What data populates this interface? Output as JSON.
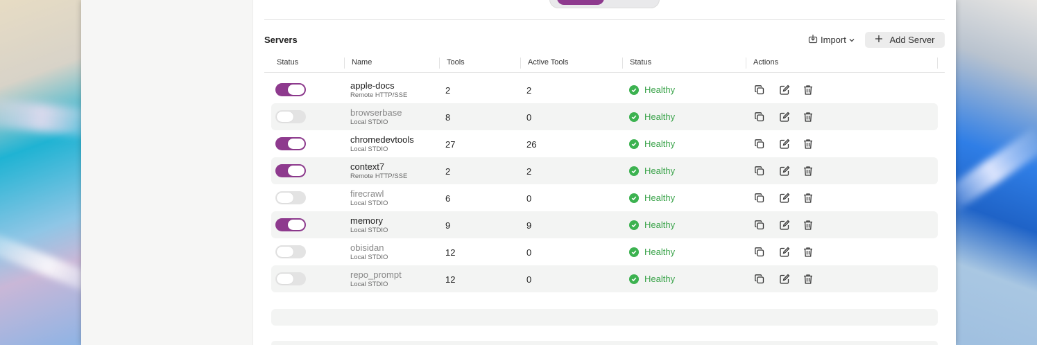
{
  "header": {
    "segment_active_color": "#8e3a8e"
  },
  "servers": {
    "title": "Servers",
    "import_label": "Import",
    "add_label": "Add Server"
  },
  "table": {
    "columns": [
      "Status",
      "Name",
      "Tools",
      "Active Tools",
      "Status",
      "Actions"
    ],
    "rows": [
      {
        "enabled": true,
        "name": "apple-docs",
        "type": "Remote HTTP/SSE",
        "tools": "2",
        "active": "2",
        "status": "Healthy"
      },
      {
        "enabled": false,
        "name": "browserbase",
        "type": "Local STDIO",
        "tools": "8",
        "active": "0",
        "status": "Healthy"
      },
      {
        "enabled": true,
        "name": "chromedevtools",
        "type": "Local STDIO",
        "tools": "27",
        "active": "26",
        "status": "Healthy"
      },
      {
        "enabled": true,
        "name": "context7",
        "type": "Remote HTTP/SSE",
        "tools": "2",
        "active": "2",
        "status": "Healthy"
      },
      {
        "enabled": false,
        "name": "firecrawl",
        "type": "Local STDIO",
        "tools": "6",
        "active": "0",
        "status": "Healthy"
      },
      {
        "enabled": true,
        "name": "memory",
        "type": "Local STDIO",
        "tools": "9",
        "active": "9",
        "status": "Healthy"
      },
      {
        "enabled": false,
        "name": "obisidan",
        "type": "Local STDIO",
        "tools": "12",
        "active": "0",
        "status": "Healthy"
      },
      {
        "enabled": false,
        "name": "repo_prompt",
        "type": "Local STDIO",
        "tools": "12",
        "active": "0",
        "status": "Healthy"
      }
    ]
  },
  "icons": {
    "import": "import-icon",
    "chevron": "chevron-down-icon",
    "add": "plus-icon",
    "check": "check-circle-icon",
    "copy": "copy-icon",
    "edit": "edit-icon",
    "delete": "trash-icon"
  },
  "colors": {
    "accent": "#8e3a8e",
    "healthy": "#3aa34a"
  }
}
